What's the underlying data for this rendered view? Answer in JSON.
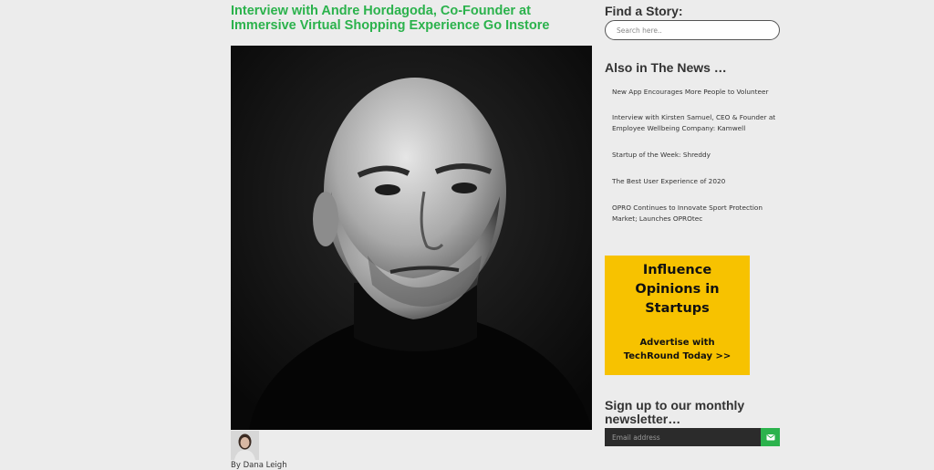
{
  "article": {
    "title": "Interview with Andre Hordagoda, Co-Founder at Immersive Virtual Shopping Experience Go Instore",
    "byline": "By Dana Leigh"
  },
  "sidebar": {
    "find_heading": "Find a Story:",
    "search_placeholder": "Search here..",
    "news_heading": "Also in The News …",
    "news_items": [
      "New App Encourages More People to Volunteer",
      "Interview with Kirsten Samuel, CEO & Founder at Employee Wellbeing Company: Kamwell",
      "Startup of the Week: Shreddy",
      "The Best User Experience of 2020",
      "OPRO Continues to Innovate Sport Protection Market; Launches OPROtec"
    ],
    "ad": {
      "headline": "Influence Opinions in Startups",
      "cta": "Advertise with TechRound Today >>"
    },
    "newsletter_heading": "Sign up to our monthly newsletter…",
    "email_placeholder": "Email address"
  },
  "colors": {
    "accent": "#2bb24c",
    "ad_bg": "#f7c200",
    "page_bg": "#ececec"
  },
  "icons": {
    "subscribe": "envelope-icon"
  }
}
